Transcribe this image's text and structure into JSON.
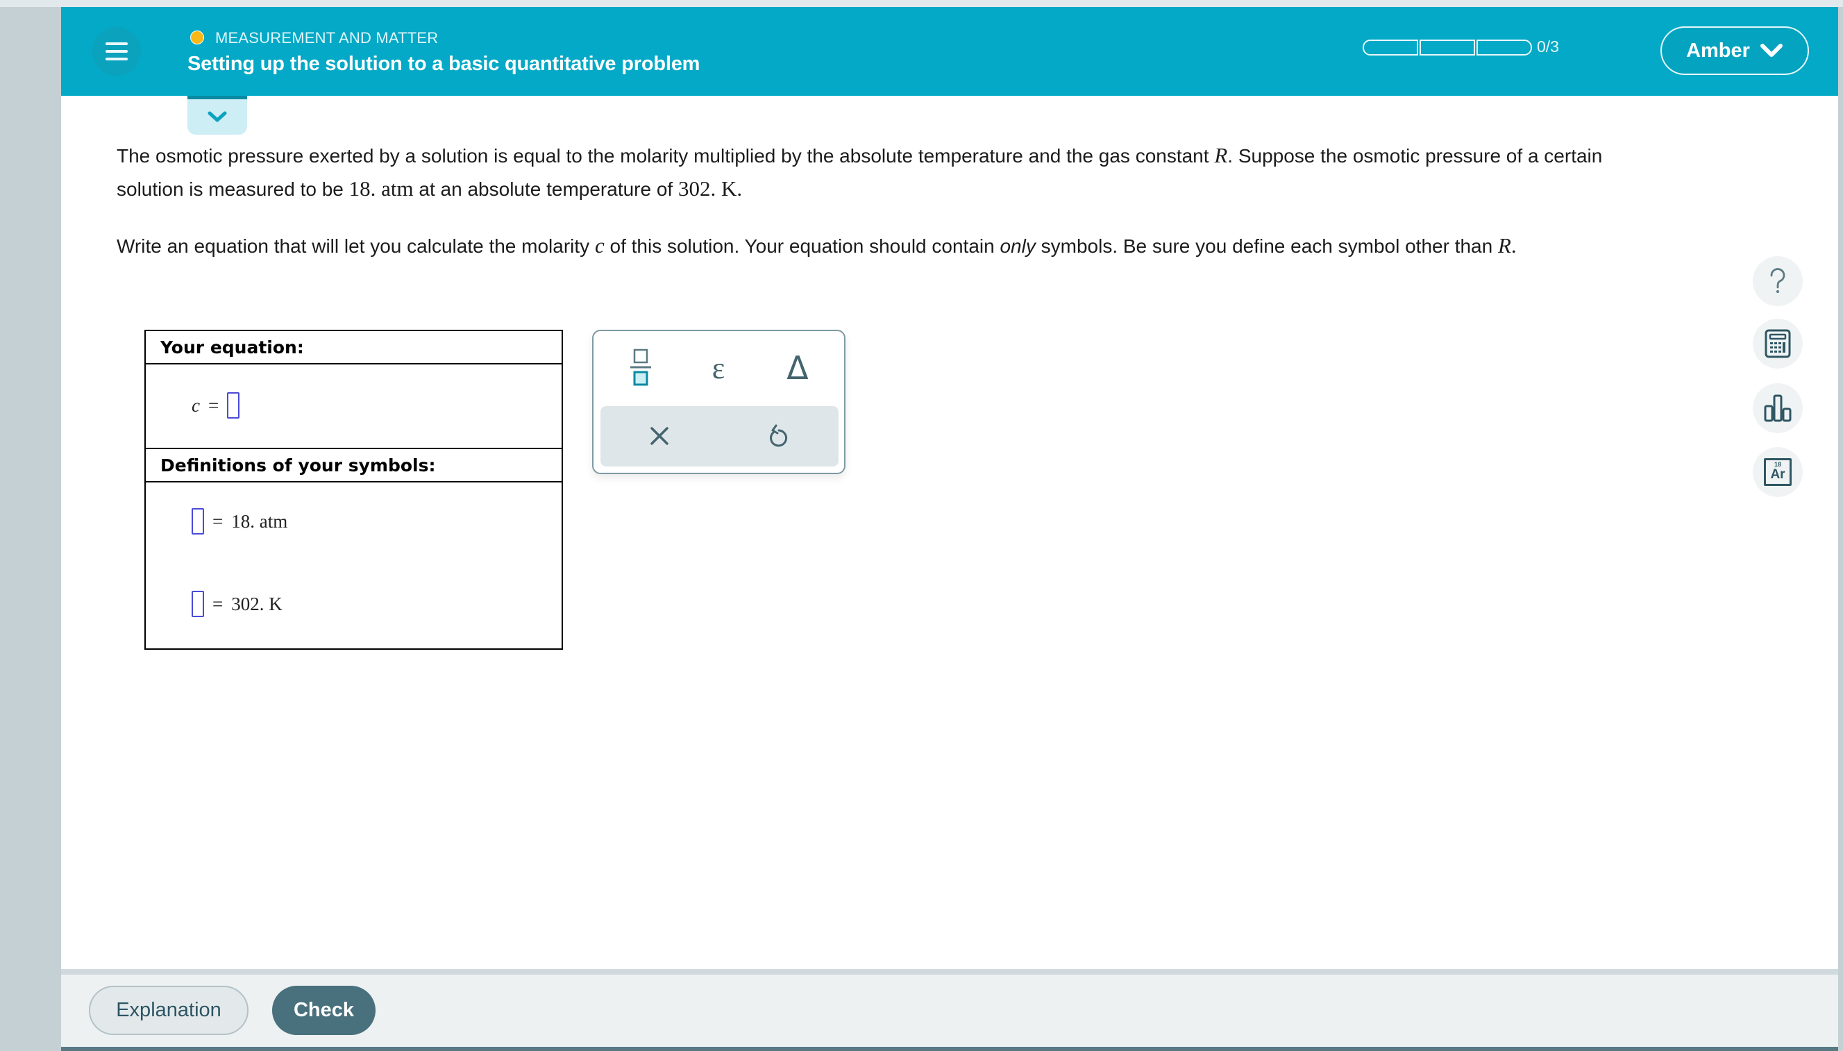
{
  "header": {
    "topic": "MEASUREMENT AND MATTER",
    "topic_status_color": "#f8b817",
    "title": "Setting up the solution to a basic quantitative problem",
    "progress": {
      "completed": 0,
      "total": 3,
      "label": "0/3"
    },
    "user_name": "Amber",
    "accent_color": "#03a9c6"
  },
  "problem": {
    "para1": {
      "t1": "The osmotic pressure exerted by a solution is equal to the molarity multiplied by the absolute temperature and the gas constant ",
      "R": "R",
      "t2": ". Suppose the osmotic pressure of a certain solution is measured to be ",
      "pressure": "18. atm",
      "t3": " at an absolute temperature of ",
      "temperature": "302. K",
      "t4": "."
    },
    "para2": {
      "t1": "Write an equation that will let you calculate the molarity ",
      "c": "c",
      "t2": " of this solution. Your equation should contain ",
      "only": "only",
      "t3": " symbols. Be sure you define each symbol other than ",
      "R": "R",
      "t4": "."
    }
  },
  "answer_table": {
    "equation_header": "Your equation:",
    "equation_lhs": "c",
    "equals": "=",
    "equation_rhs_value": "",
    "definitions_header": "Definitions of your symbols:",
    "definitions": [
      {
        "symbol": "",
        "equals": "=",
        "value": "18. atm"
      },
      {
        "symbol": "",
        "equals": "=",
        "value": "302. K"
      }
    ]
  },
  "palette": {
    "buttons": [
      {
        "name": "fraction",
        "icon": "fraction-icon"
      },
      {
        "name": "epsilon",
        "glyph": "ε"
      },
      {
        "name": "delta",
        "glyph": "Δ"
      }
    ],
    "actions": [
      {
        "name": "clear",
        "icon": "close-icon"
      },
      {
        "name": "undo",
        "icon": "undo-icon"
      }
    ]
  },
  "side_tools": [
    {
      "name": "help",
      "icon": "question-icon"
    },
    {
      "name": "calculator",
      "icon": "calculator-icon"
    },
    {
      "name": "data",
      "icon": "bar-chart-icon"
    },
    {
      "name": "periodic-table",
      "icon": "periodic-table-icon",
      "number": "18",
      "symbol": "Ar"
    }
  ],
  "footer": {
    "explanation_label": "Explanation",
    "check_label": "Check"
  }
}
